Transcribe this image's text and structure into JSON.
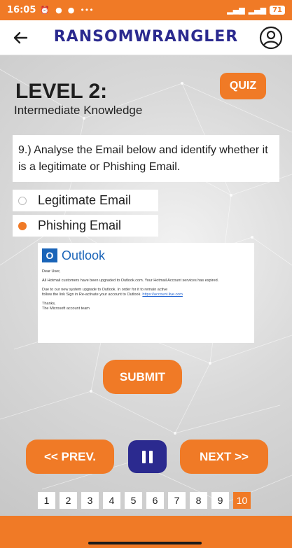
{
  "status_bar": {
    "time": "16:05",
    "battery": "71"
  },
  "app": {
    "title": "RANSOMWRANGLER"
  },
  "level": {
    "title": "LEVEL 2:",
    "subtitle": "Intermediate Knowledge"
  },
  "quiz_label": "QUIZ",
  "question": {
    "text": "9.) Analyse the Email below and identify whether it is a legitimate or Phishing Email."
  },
  "options": [
    {
      "label": "Legitimate Email",
      "selected": false
    },
    {
      "label": "Phishing Email",
      "selected": true
    }
  ],
  "email": {
    "brand": "Outlook",
    "greeting": "Dear User,",
    "line1": "All Hotmail customers have been upgraded to Outlook.com. Your Hotmail Account services has expired.",
    "line2": "Due to our new system upgrade to Outlook. In order for it to remain active",
    "line3": "follow the link Sign in Re-activate your account to Outlook.",
    "link": "https://account.live.com",
    "signoff": "Thanks,",
    "signature": "The Microsoft account team"
  },
  "submit_label": "SUBMIT",
  "nav": {
    "prev_label": "<< PREV.",
    "next_label": "NEXT >>"
  },
  "pages": [
    "1",
    "2",
    "3",
    "4",
    "5",
    "6",
    "7",
    "8",
    "9",
    "10"
  ],
  "current_page": "10",
  "colors": {
    "accent": "#f07a26",
    "brand_blue": "#2b2a8f"
  }
}
